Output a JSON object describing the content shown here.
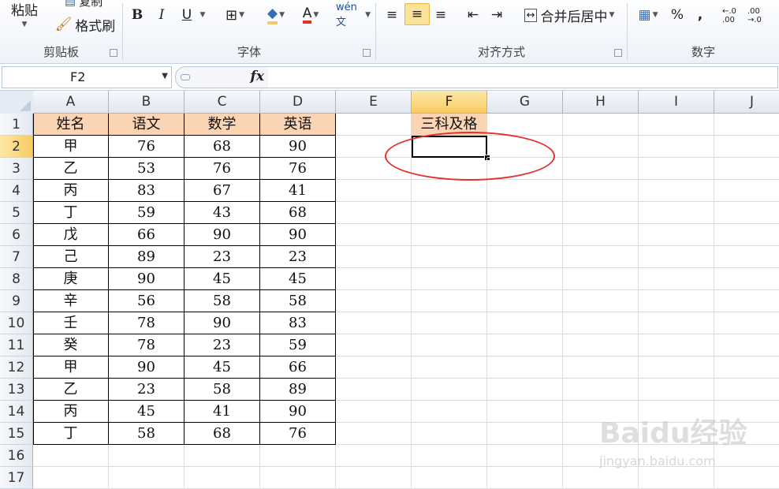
{
  "ribbon": {
    "clipboard": {
      "label": "剪贴板",
      "paste": "粘贴",
      "copy": "复制",
      "format_painter": "格式刷"
    },
    "font": {
      "label": "字体",
      "bold": "B",
      "italic": "I",
      "underline": "U",
      "font_color": "A",
      "phonetic": "wén 文"
    },
    "alignment": {
      "label": "对齐方式",
      "merge_center": "合并后居中"
    },
    "number": {
      "label": "数字",
      "percent": "%",
      "comma": ",",
      "inc_decimal": "←.0 .00",
      "dec_decimal": ".00 →.0"
    }
  },
  "formula_bar": {
    "name_box": "F2",
    "fx": "fx",
    "formula": ""
  },
  "columns": [
    "A",
    "B",
    "C",
    "D",
    "E",
    "F",
    "G",
    "H",
    "I",
    "J"
  ],
  "rows": [
    "1",
    "2",
    "3",
    "4",
    "5",
    "6",
    "7",
    "8",
    "9",
    "10",
    "11",
    "12",
    "13",
    "14",
    "15",
    "16",
    "17"
  ],
  "selected": {
    "column": "F",
    "row": "2"
  },
  "table": {
    "headers": [
      "姓名",
      "语文",
      "数学",
      "英语"
    ],
    "data": [
      [
        "甲",
        "76",
        "68",
        "90"
      ],
      [
        "乙",
        "53",
        "76",
        "76"
      ],
      [
        "丙",
        "83",
        "67",
        "41"
      ],
      [
        "丁",
        "59",
        "43",
        "68"
      ],
      [
        "戊",
        "66",
        "90",
        "90"
      ],
      [
        "己",
        "89",
        "23",
        "23"
      ],
      [
        "庚",
        "90",
        "45",
        "45"
      ],
      [
        "辛",
        "56",
        "58",
        "58"
      ],
      [
        "壬",
        "78",
        "90",
        "83"
      ],
      [
        "癸",
        "78",
        "23",
        "59"
      ],
      [
        "甲",
        "90",
        "45",
        "66"
      ],
      [
        "乙",
        "23",
        "58",
        "89"
      ],
      [
        "丙",
        "45",
        "41",
        "90"
      ],
      [
        "丁",
        "58",
        "68",
        "76"
      ]
    ]
  },
  "f1_header": "三科及格",
  "watermark": {
    "brand": "Baidu经验",
    "url": "jingyan.baidu.com"
  },
  "colors": {
    "header_fill": "#fbd4b4",
    "highlight": "#e0312d",
    "selection_header": "#f8cb62"
  }
}
